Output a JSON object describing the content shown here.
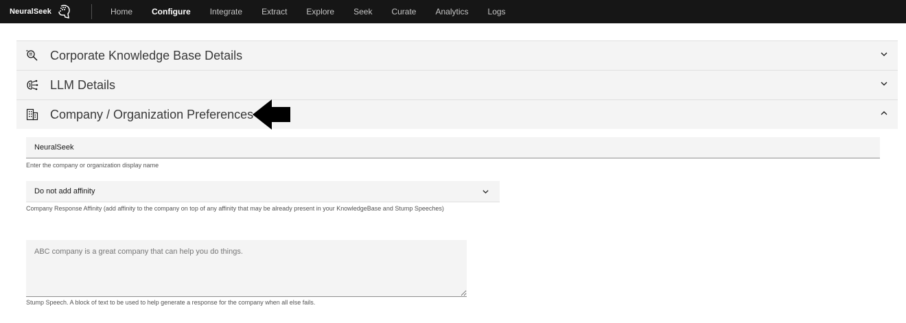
{
  "brand": {
    "name": "NeuralSeek",
    "logo_icon": "neural-head-icon"
  },
  "nav": {
    "items": [
      {
        "label": "Home"
      },
      {
        "label": "Configure",
        "active": true
      },
      {
        "label": "Integrate"
      },
      {
        "label": "Extract"
      },
      {
        "label": "Explore"
      },
      {
        "label": "Seek"
      },
      {
        "label": "Curate"
      },
      {
        "label": "Analytics"
      },
      {
        "label": "Logs"
      }
    ]
  },
  "accordion": {
    "sections": [
      {
        "title": "Corporate Knowledge Base Details",
        "icon": "search-document-icon",
        "expanded": false
      },
      {
        "title": "LLM Details",
        "icon": "machine-learning-icon",
        "expanded": false
      },
      {
        "title": "Company / Organization Preferences",
        "icon": "building-icon",
        "expanded": true
      }
    ]
  },
  "preferences": {
    "company_name": {
      "value": "NeuralSeek",
      "helper": "Enter the company or organization display name"
    },
    "affinity": {
      "selected": "Do not add affinity",
      "helper": "Company Response Affinity (add affinity to the company on top of any affinity that may be already present in your KnowledgeBase and Stump Speeches)"
    },
    "stump_speech": {
      "placeholder": "ABC company is a great company that can help you do things.",
      "helper": "Stump Speech. A block of text to be used to help generate a response for the company when all else fails."
    }
  },
  "annotation": {
    "icon": "left-arrow-icon",
    "color": "#000000"
  }
}
